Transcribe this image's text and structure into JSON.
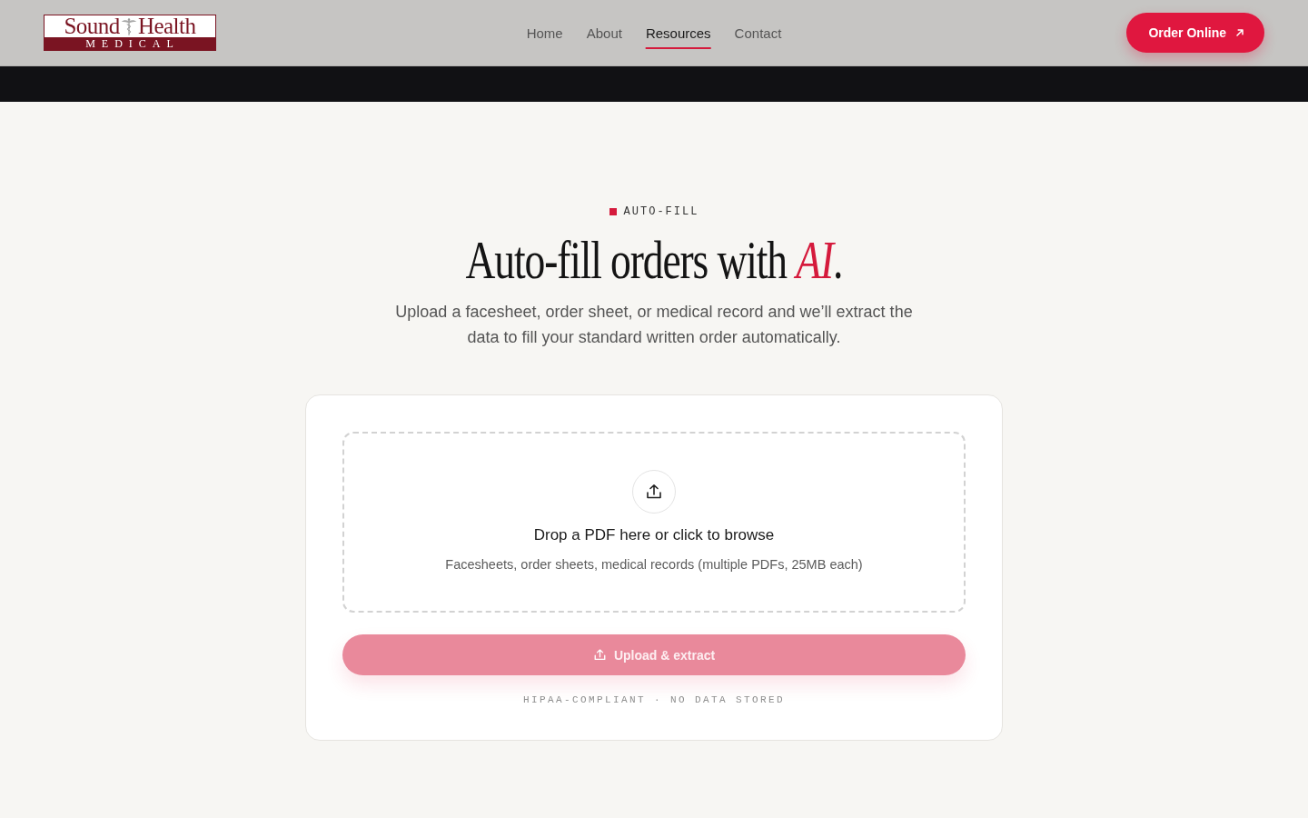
{
  "header": {
    "logo": {
      "word_left": "Sound",
      "word_right": "Health",
      "band": "MEDICAL"
    },
    "nav": [
      {
        "label": "Home",
        "selected": false
      },
      {
        "label": "About",
        "selected": false
      },
      {
        "label": "Resources",
        "selected": true
      },
      {
        "label": "Contact",
        "selected": false
      }
    ],
    "cta": {
      "label": "Order Online"
    }
  },
  "hero": {
    "eyebrow": "AUTO-FILL",
    "title": "Auto-fill orders with *AI*.",
    "subtitle": "Upload a facesheet, order sheet, or medical record and we’ll extract the data to fill your standard written order automatically."
  },
  "upload_card": {
    "dropzone": {
      "title": "Drop a PDF here or click to browse",
      "hint": "Facesheets, order sheets, medical records (multiple PDFs, 25MB each)"
    },
    "button": {
      "label": "Upload & extract",
      "disabled": true
    },
    "note": "HIPAA-COMPLIANT · NO DATA STORED"
  }
}
